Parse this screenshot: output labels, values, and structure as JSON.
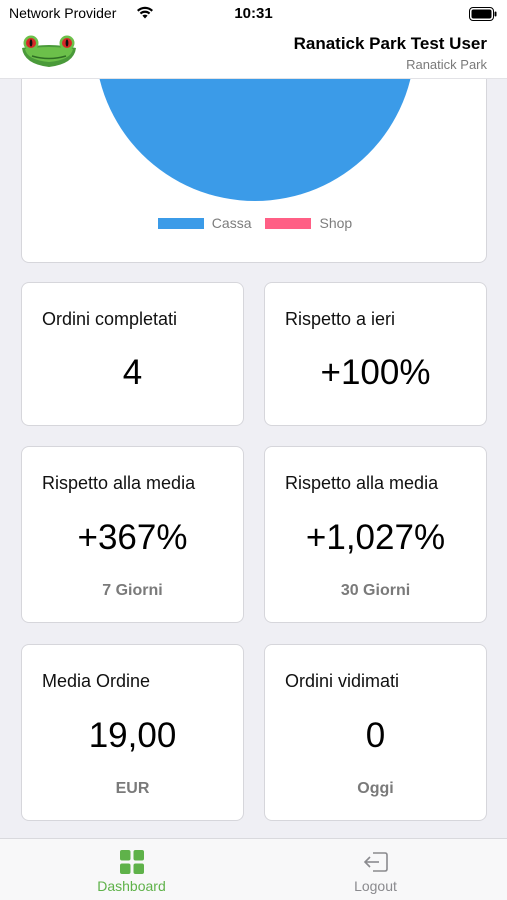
{
  "status_bar": {
    "carrier": "Network Provider",
    "time": "10:31"
  },
  "header": {
    "user_name": "Ranatick Park Test User",
    "park_name": "Ranatick Park",
    "logo_icon": "frog-logo-icon"
  },
  "chart_data": {
    "type": "pie",
    "labels": [
      "Cassa",
      "Shop"
    ],
    "values": [
      100,
      0
    ],
    "colors": [
      "#3b9be8",
      "#ff5f85"
    ],
    "legend_position": "bottom",
    "title": ""
  },
  "cards": [
    {
      "title": "Ordini completati",
      "value": "4",
      "sub": ""
    },
    {
      "title": "Rispetto a ieri",
      "value": "+100%",
      "sub": ""
    },
    {
      "title": "Rispetto alla media",
      "value": "+367%",
      "sub": "7 Giorni"
    },
    {
      "title": "Rispetto alla media",
      "value": "+1,027%",
      "sub": "30 Giorni"
    },
    {
      "title": "Media Ordine",
      "value": "19,00",
      "sub": "EUR"
    },
    {
      "title": "Ordini vidimati",
      "value": "0",
      "sub": "Oggi"
    }
  ],
  "tabs": [
    {
      "label": "Dashboard",
      "icon": "grid-icon",
      "active": true,
      "color": "#5fb24a"
    },
    {
      "label": "Logout",
      "icon": "logout-icon",
      "active": false,
      "color": "#8a8a8e"
    }
  ]
}
